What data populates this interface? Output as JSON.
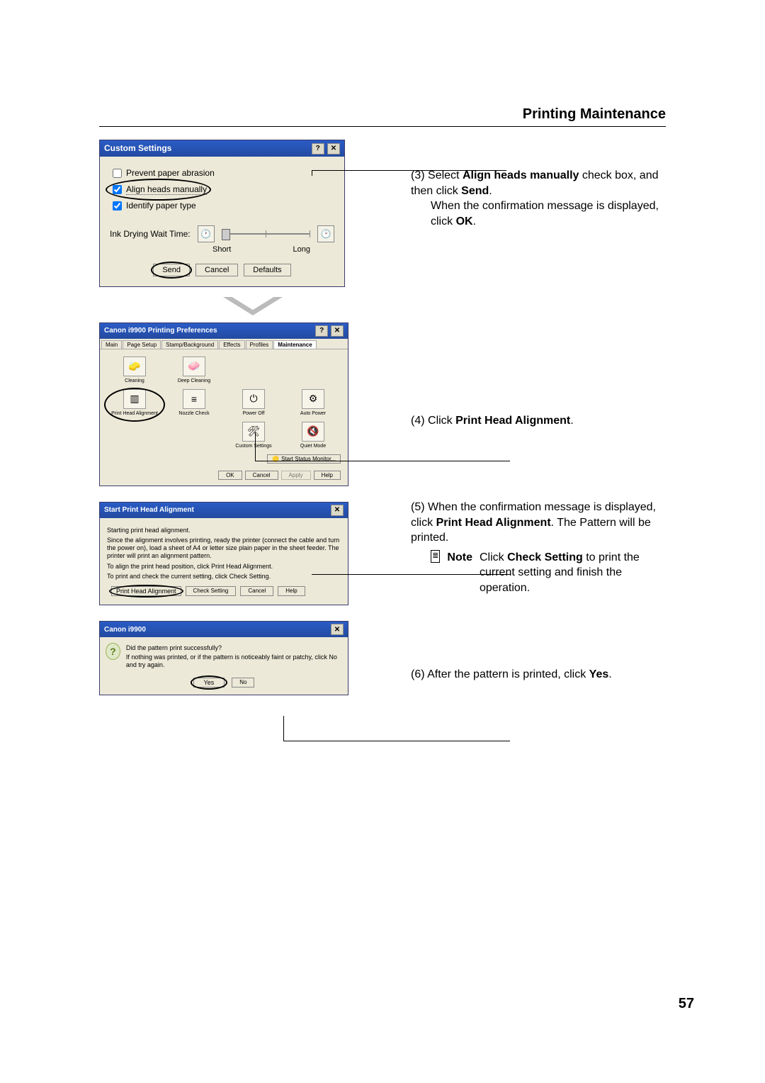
{
  "page_title": "Printing Maintenance",
  "page_number": "57",
  "custom_settings": {
    "title": "Custom Settings",
    "prevent_abrasion_label": "Prevent paper abrasion",
    "align_heads_label": "Align heads manually",
    "identify_paper_label": "Identify paper type",
    "ink_dry_label": "Ink Drying Wait Time:",
    "slider_short_label": "Short",
    "slider_long_label": "Long",
    "send_btn": "Send",
    "cancel_btn": "Cancel",
    "defaults_btn": "Defaults"
  },
  "prefs": {
    "title": "Canon i9900 Printing Preferences",
    "tabs": [
      "Main",
      "Page Setup",
      "Stamp/Background",
      "Effects",
      "Profiles",
      "Maintenance"
    ],
    "cells": {
      "cleaning": "Cleaning",
      "deep_cleaning": "Deep Cleaning",
      "print_head_alignment": "Print Head Alignment",
      "nozzle_check": "Nozzle Check",
      "power_off": "Power Off",
      "auto_power": "Auto Power",
      "custom_settings": "Custom Settings",
      "quiet_mode": "Quiet Mode"
    },
    "status_monitor_btn": "Start Status Monitor...",
    "ok_btn": "OK",
    "cancel_btn": "Cancel",
    "apply_btn": "Apply",
    "help_btn": "Help"
  },
  "start_pha": {
    "title": "Start Print Head Alignment",
    "line1": "Starting print head alignment.",
    "line2": "Since the alignment involves printing, ready the printer (connect the cable and turn the power on), load a sheet of A4 or letter size plain paper in the sheet feeder. The printer will print an alignment pattern.",
    "line3": "To align the print head position, click Print Head Alignment.",
    "line4": "To print and check the current setting, click Check Setting.",
    "pha_btn": "Print Head Alignment",
    "check_btn": "Check Setting",
    "cancel_btn": "Cancel",
    "help_btn": "Help"
  },
  "confirm": {
    "title": "Canon i9900",
    "line1": "Did the pattern print successfully?",
    "line2": "If nothing was printed, or if the pattern is noticeably faint or patchy, click No and try again.",
    "yes_btn": "Yes",
    "no_btn": "No"
  },
  "steps": {
    "s3": {
      "n": "(3)",
      "text_a": "Select ",
      "bold_a": "Align heads manually",
      "text_b": " check box, and then click ",
      "bold_b": "Send",
      "text_c": ".",
      "text_d": "When the confirmation message is displayed, click ",
      "bold_c": "OK",
      "text_e": "."
    },
    "s4": {
      "n": "(4)",
      "text_a": "Click ",
      "bold_a": "Print Head Alignment",
      "text_b": "."
    },
    "s5": {
      "n": "(5)",
      "text_a": "When the confirmation message is displayed, click ",
      "bold_a": "Print Head Alignment",
      "text_b": ". The Pattern will be printed.",
      "note_label": "Note",
      "note_text_a": "Click ",
      "note_bold": "Check Setting",
      "note_text_b": " to print the current setting and finish the operation."
    },
    "s6": {
      "n": "(6)",
      "text_a": "After the pattern is printed, click ",
      "bold_a": "Yes",
      "text_b": "."
    }
  }
}
